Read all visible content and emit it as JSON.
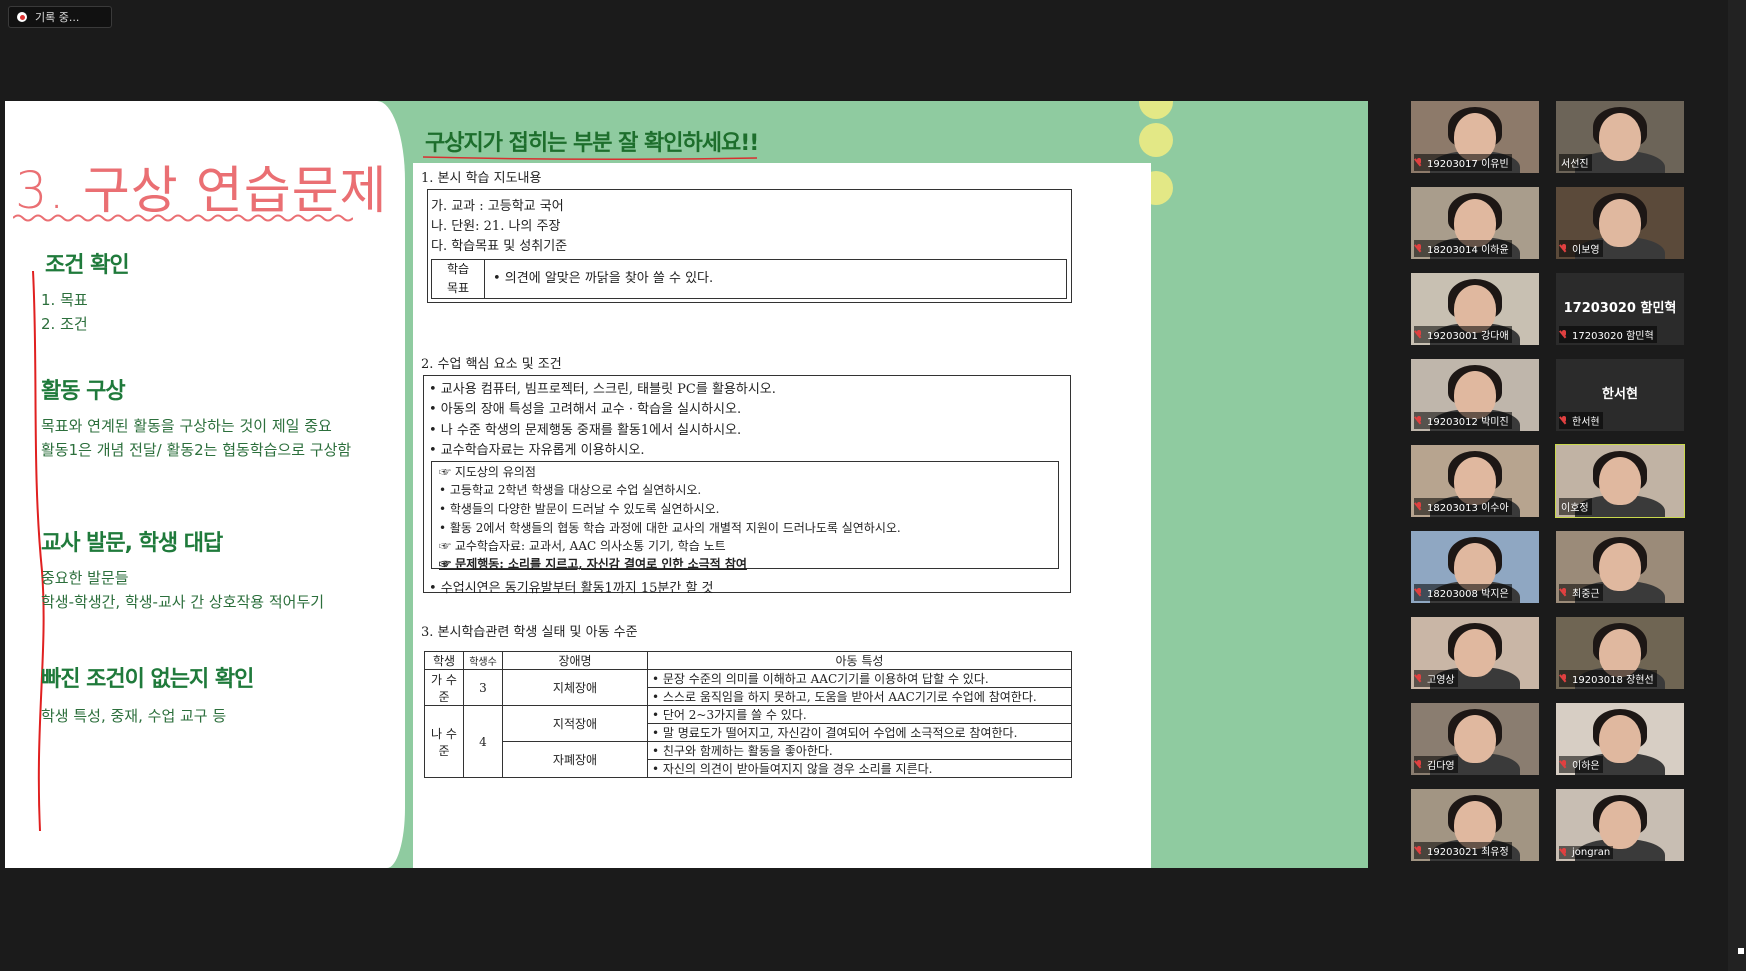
{
  "recording": {
    "label": "기록 중..."
  },
  "slide": {
    "title": "3. 구상 연습문제",
    "sections": [
      {
        "heading": "조건 확인",
        "items": [
          "1. 목표",
          "2. 조건"
        ]
      },
      {
        "heading": "활동 구상",
        "items": [
          "목표와 연계된 활동을 구상하는 것이 제일 중요",
          "활동1은 개념 전달/ 활동2는 협동학습으로 구상함"
        ]
      },
      {
        "heading": "교사 발문, 학생 대답",
        "items": [
          "중요한 발문들",
          "학생-학생간, 학생-교사 간 상호작용 적어두기"
        ]
      },
      {
        "heading": "빠진 조건이 없는지 확인",
        "items": [
          "학생 특성, 중재, 수업 교구 등"
        ]
      }
    ],
    "headline": "구상지가 접히는 부분 잘 확인하세요!!",
    "doc": {
      "s1_title": "1. 본시 학습 지도내용",
      "s1_lines": [
        "가. 교과 : 고등학교 국어",
        "나. 단원: 21. 나의 주장",
        "다. 학습목표 및 성취기준"
      ],
      "goal_label_1": "학습",
      "goal_label_2": "목표",
      "goal_text": "•  의견에 알맞은 까닭을 찾아 쓸 수 있다.",
      "s2_title": "2. 수업 핵심 요소 및 조건",
      "s2_lines": [
        "• 교사용 컴퓨터, 빔프로젝터, 스크린, 태블릿 PC를 활용하시오.",
        "• 아동의 장애 특성을 고려해서 교수 · 학습을 실시하시오.",
        "• 나 수준 학생의 문제행동 중재를 활동1에서 실시하시오.",
        "• 교수학습자료는 자유롭게 이용하시오."
      ],
      "notes_title": "☞ 지도상의 유의점",
      "notes": [
        "•  고등학교 2학년 학생을 대상으로 수업 실연하시오.",
        "•  학생들의 다양한 발문이 드러날 수 있도록 실연하시오.",
        "•  활동 2에서 학생들의 협동 학습 과정에 대한 교사의 개별적 지원이 드러나도록 실연하시오."
      ],
      "materials": "☞ 교수학습자료: 교과서, AAC 의사소통 기기, 학습 노트",
      "behavior": "☞ 문제행동: 소리를 지르고, 자신감 결여로 인한 소극적 참여",
      "s2_last": "• 수업시연은 동기유발부터 활동1까지 15분간 할 것",
      "s3_title": "3. 본시학습관련 학생 실태 및 아동 수준",
      "table_headers": [
        "학생",
        "학생수",
        "장애명",
        "아동 특성"
      ],
      "rows": [
        {
          "group": "가 수준",
          "count": "3",
          "disability": "지체장애",
          "traits": [
            "•  문장 수준의 의미를 이해하고 AAC기기를 이용하여 답할 수 있다.",
            "•  스스로 움직임을 하지 못하고, 도움을 받아서 AAC기기로 수업에 참여한다."
          ]
        },
        {
          "group": "나 수준",
          "count": "4",
          "disability": "지적장애",
          "traits": [
            "•  단어 2~3가지를 쓸 수 있다.",
            "•  말 명료도가 떨어지고, 자신감이 결여되어 수업에 소극적으로 참여한다."
          ]
        },
        {
          "group": "",
          "count": "",
          "disability": "자폐장애",
          "traits": [
            "•  친구와 함께하는 활동을 좋아한다.",
            "•  자신의 의견이 받아들여지지 않을 경우 소리를 지른다."
          ]
        }
      ]
    }
  },
  "participants": [
    {
      "name": "19203017 이유빈",
      "muted": true,
      "video": true
    },
    {
      "name": "서선진",
      "muted": false,
      "video": true
    },
    {
      "name": "18203014 이하윤",
      "muted": true,
      "video": true
    },
    {
      "name": "이보영",
      "muted": true,
      "video": true
    },
    {
      "name": "19203001 강다애",
      "muted": true,
      "video": true
    },
    {
      "name": "17203020 함민혁",
      "muted": true,
      "video": false,
      "display": "17203020 함민혁"
    },
    {
      "name": "19203012 박미진",
      "muted": true,
      "video": true
    },
    {
      "name": "한서현",
      "muted": true,
      "video": false,
      "display": "한서현"
    },
    {
      "name": "18203013 이수아",
      "muted": true,
      "video": true
    },
    {
      "name": "이호정",
      "muted": false,
      "video": true,
      "active": true
    },
    {
      "name": "18203008 박지은",
      "muted": true,
      "video": true
    },
    {
      "name": "최중근",
      "muted": true,
      "video": true
    },
    {
      "name": "고영상",
      "muted": true,
      "video": true
    },
    {
      "name": "19203018 장현선",
      "muted": true,
      "video": true
    },
    {
      "name": "김다영",
      "muted": true,
      "video": true
    },
    {
      "name": "이하은",
      "muted": true,
      "video": true
    },
    {
      "name": "19203021 최유정",
      "muted": true,
      "video": true
    },
    {
      "name": "jongran",
      "muted": true,
      "video": true
    }
  ],
  "colors": {
    "slide_bg": "#8fcba0",
    "title": "#ea6f73",
    "section": "#1f7a3b",
    "active_speaker": "#c9d84c"
  }
}
